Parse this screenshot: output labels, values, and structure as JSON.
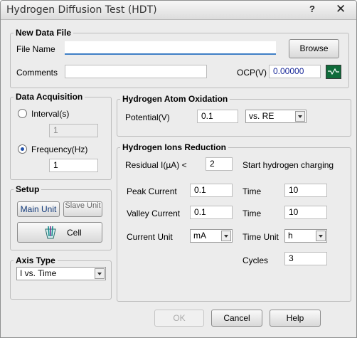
{
  "window": {
    "title": "Hydrogen Diffusion Test (HDT)",
    "help_glyph": "?",
    "close_glyph": "✕"
  },
  "new_data_file": {
    "legend": "New Data File",
    "file_name_label": "File Name",
    "file_name_value": "",
    "browse_label": "Browse",
    "comments_label": "Comments",
    "comments_value": "",
    "ocp_label": "OCP(V)",
    "ocp_value": "0.00000",
    "ocp_icon": "waveform-icon"
  },
  "data_acquisition": {
    "legend": "Data Acquisition",
    "interval_label": "Interval(s)",
    "interval_value": "1",
    "frequency_label": "Frequency(Hz)",
    "frequency_value": "1",
    "selected": "frequency"
  },
  "setup": {
    "legend": "Setup",
    "main_unit_label": "Main Unit",
    "slave_unit_label": "Slave Unit",
    "cell_label": "Cell",
    "cell_icon": "electrochemical-cell-icon"
  },
  "axis_type": {
    "legend": "Axis Type",
    "selected": "I vs. Time"
  },
  "oxidation": {
    "legend": "Hydrogen Atom Oxidation",
    "potential_label": "Potential(V)",
    "potential_value": "0.1",
    "reference_selected": "vs. RE"
  },
  "reduction": {
    "legend": "Hydrogen Ions Reduction",
    "residual_label": "Residual I(µA) <",
    "residual_value": "2",
    "start_charging_label": "Start hydrogen charging",
    "peak_current_label": "Peak Current",
    "peak_current_value": "0.1",
    "valley_current_label": "Valley Current",
    "valley_current_value": "0.1",
    "current_unit_label": "Current Unit",
    "current_unit_selected": "mA",
    "time_label_1": "Time",
    "time_value_1": "10",
    "time_label_2": "Time",
    "time_value_2": "10",
    "time_unit_label": "Time Unit",
    "time_unit_selected": "h",
    "cycles_label": "Cycles",
    "cycles_value": "3"
  },
  "buttons": {
    "ok": "OK",
    "cancel": "Cancel",
    "help": "Help"
  }
}
